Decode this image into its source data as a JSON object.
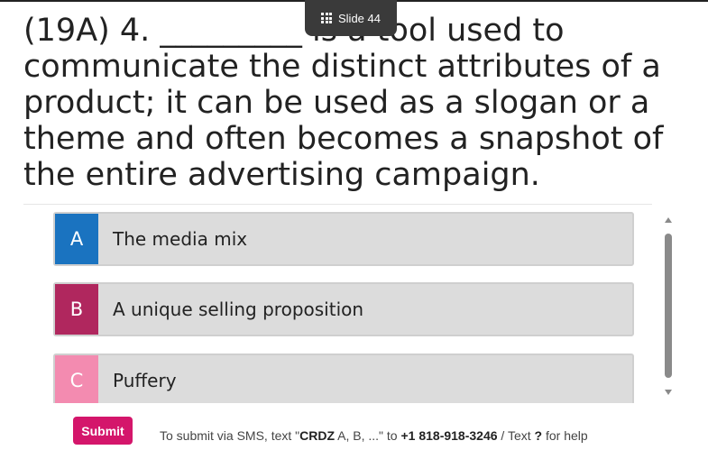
{
  "slide": {
    "label": "Slide 44",
    "icon": "grid-icon"
  },
  "question": {
    "text": "(19A) 4. _________ is a tool used to communicate the distinct attributes of a product; it can be used as a slogan or a theme and often becomes a snapshot of the entire advertising campaign."
  },
  "options": [
    {
      "letter": "A",
      "text": "The media mix",
      "color": "#1a73c0"
    },
    {
      "letter": "B",
      "text": "A unique selling proposition",
      "color": "#b0275e"
    },
    {
      "letter": "C",
      "text": "Puffery",
      "color": "#f38bb0"
    }
  ],
  "footer": {
    "submit_label": "Submit",
    "submit_color": "#d4166b",
    "sms_prefix": "To submit via SMS, text \"",
    "sms_code": "CRDZ",
    "sms_mid": " A, B, ...\" to ",
    "sms_number": "+1 818-918-3246",
    "sms_sep": " / Text ",
    "sms_help": "?",
    "sms_suffix": " for help"
  }
}
